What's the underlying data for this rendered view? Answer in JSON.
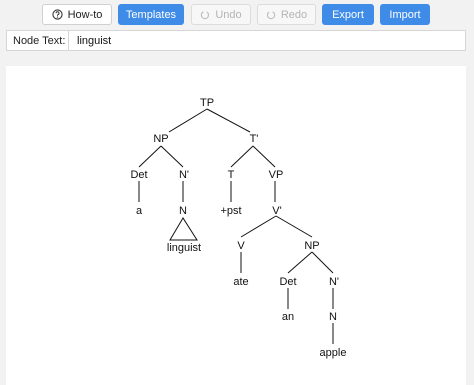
{
  "toolbar": {
    "howto_label": "How-to",
    "templates_label": "Templates",
    "undo_label": "Undo",
    "redo_label": "Redo",
    "export_label": "Export",
    "import_label": "Import"
  },
  "node_text": {
    "label": "Node Text:",
    "value": "linguist"
  },
  "tree": {
    "tp": "TP",
    "np1": "NP",
    "tbar": "T'",
    "det1": "Det",
    "nbar1": "N'",
    "t": "T",
    "vp": "VP",
    "a": "a",
    "n1": "N",
    "pst": "+pst",
    "vbar": "V'",
    "linguist": "linguist",
    "v": "V",
    "np2": "NP",
    "ate": "ate",
    "det2": "Det",
    "nbar2": "N'",
    "an": "an",
    "n2": "N",
    "apple": "apple"
  }
}
